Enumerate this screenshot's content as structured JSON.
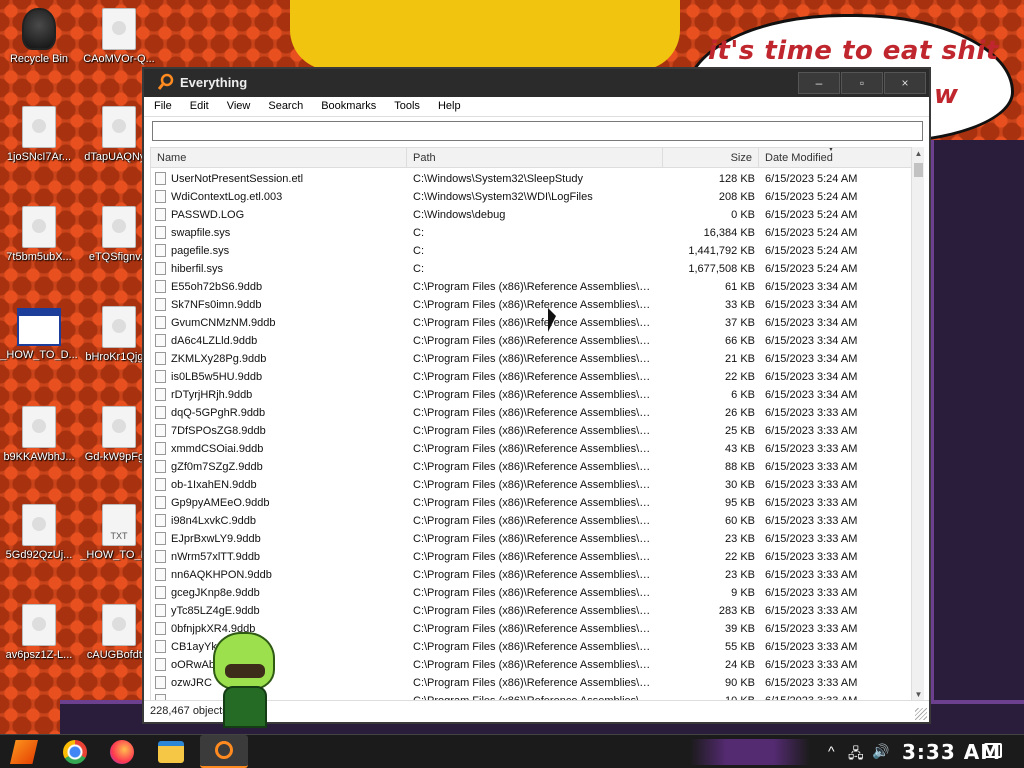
{
  "desktop": {
    "speech_text": "it's time to eat shit",
    "speech_text2": "w",
    "icons": [
      {
        "label": "Recycle Bin"
      },
      {
        "label": "CAoMVOr-Q..."
      },
      {
        "label": "1joSNcI7Ar..."
      },
      {
        "label": "dTapUAQNy..."
      },
      {
        "label": "7t5bm5ubX..."
      },
      {
        "label": "eTQSfignv..."
      },
      {
        "label": "_HOW_TO_D..."
      },
      {
        "label": "bHroKr1Qjg..."
      },
      {
        "label": "b9KKAWbhJ..."
      },
      {
        "label": "Gd-kW9pFg..."
      },
      {
        "label": "5Gd92QzUj..."
      },
      {
        "label": "_HOW_TO_D..."
      },
      {
        "label": "av6psz1Z-L..."
      },
      {
        "label": "cAUGBofdt..."
      }
    ],
    "txt_badge": "TXT"
  },
  "window": {
    "title": "Everything",
    "minimize": "–",
    "maximize": "▫",
    "close": "×",
    "menu": [
      "File",
      "Edit",
      "View",
      "Search",
      "Bookmarks",
      "Tools",
      "Help"
    ],
    "search_value": "",
    "columns": {
      "name": "Name",
      "path": "Path",
      "size": "Size",
      "date": "Date Modified"
    },
    "rows": [
      {
        "name": "UserNotPresentSession.etl",
        "path": "C:\\Windows\\System32\\SleepStudy",
        "size": "128 KB",
        "date": "6/15/2023 5:24 AM"
      },
      {
        "name": "WdiContextLog.etl.003",
        "path": "C:\\Windows\\System32\\WDI\\LogFiles",
        "size": "208 KB",
        "date": "6/15/2023 5:24 AM"
      },
      {
        "name": "PASSWD.LOG",
        "path": "C:\\Windows\\debug",
        "size": "0 KB",
        "date": "6/15/2023 5:24 AM"
      },
      {
        "name": "swapfile.sys",
        "path": "C:",
        "size": "16,384 KB",
        "date": "6/15/2023 5:24 AM"
      },
      {
        "name": "pagefile.sys",
        "path": "C:",
        "size": "1,441,792 KB",
        "date": "6/15/2023 5:24 AM"
      },
      {
        "name": "hiberfil.sys",
        "path": "C:",
        "size": "1,677,508 KB",
        "date": "6/15/2023 5:24 AM"
      },
      {
        "name": "E55oh72bS6.9ddb",
        "path": "C:\\Program Files (x86)\\Reference Assemblies\\Mic...",
        "size": "61 KB",
        "date": "6/15/2023 3:34 AM"
      },
      {
        "name": "Sk7NFs0imn.9ddb",
        "path": "C:\\Program Files (x86)\\Reference Assemblies\\Mic...",
        "size": "33 KB",
        "date": "6/15/2023 3:34 AM"
      },
      {
        "name": "GvumCNMzNM.9ddb",
        "path": "C:\\Program Files (x86)\\Reference Assemblies\\Mic...",
        "size": "37 KB",
        "date": "6/15/2023 3:34 AM"
      },
      {
        "name": "dA6c4LZLld.9ddb",
        "path": "C:\\Program Files (x86)\\Reference Assemblies\\Mic...",
        "size": "66 KB",
        "date": "6/15/2023 3:34 AM"
      },
      {
        "name": "ZKMLXy28Pg.9ddb",
        "path": "C:\\Program Files (x86)\\Reference Assemblies\\Mic...",
        "size": "21 KB",
        "date": "6/15/2023 3:34 AM"
      },
      {
        "name": "is0LB5w5HU.9ddb",
        "path": "C:\\Program Files (x86)\\Reference Assemblies\\Mic...",
        "size": "22 KB",
        "date": "6/15/2023 3:34 AM"
      },
      {
        "name": "rDTyrjHRjh.9ddb",
        "path": "C:\\Program Files (x86)\\Reference Assemblies\\Mic...",
        "size": "6 KB",
        "date": "6/15/2023 3:34 AM"
      },
      {
        "name": "dqQ-5GPghR.9ddb",
        "path": "C:\\Program Files (x86)\\Reference Assemblies\\Mic...",
        "size": "26 KB",
        "date": "6/15/2023 3:33 AM"
      },
      {
        "name": "7DfSPOsZG8.9ddb",
        "path": "C:\\Program Files (x86)\\Reference Assemblies\\Mic...",
        "size": "25 KB",
        "date": "6/15/2023 3:33 AM"
      },
      {
        "name": "xmmdCSOiai.9ddb",
        "path": "C:\\Program Files (x86)\\Reference Assemblies\\Mic...",
        "size": "43 KB",
        "date": "6/15/2023 3:33 AM"
      },
      {
        "name": "gZf0m7SZgZ.9ddb",
        "path": "C:\\Program Files (x86)\\Reference Assemblies\\Mic...",
        "size": "88 KB",
        "date": "6/15/2023 3:33 AM"
      },
      {
        "name": "ob-1IxahEN.9ddb",
        "path": "C:\\Program Files (x86)\\Reference Assemblies\\Mic...",
        "size": "30 KB",
        "date": "6/15/2023 3:33 AM"
      },
      {
        "name": "Gp9pyAMEeO.9ddb",
        "path": "C:\\Program Files (x86)\\Reference Assemblies\\Mic...",
        "size": "95 KB",
        "date": "6/15/2023 3:33 AM"
      },
      {
        "name": "i98n4LxvkC.9ddb",
        "path": "C:\\Program Files (x86)\\Reference Assemblies\\Mic...",
        "size": "60 KB",
        "date": "6/15/2023 3:33 AM"
      },
      {
        "name": "EJprBxwLY9.9ddb",
        "path": "C:\\Program Files (x86)\\Reference Assemblies\\Mic...",
        "size": "23 KB",
        "date": "6/15/2023 3:33 AM"
      },
      {
        "name": "nWrm57xlTT.9ddb",
        "path": "C:\\Program Files (x86)\\Reference Assemblies\\Mic...",
        "size": "22 KB",
        "date": "6/15/2023 3:33 AM"
      },
      {
        "name": "nn6AQKHPON.9ddb",
        "path": "C:\\Program Files (x86)\\Reference Assemblies\\Mic...",
        "size": "23 KB",
        "date": "6/15/2023 3:33 AM"
      },
      {
        "name": "gcegJKnp8e.9ddb",
        "path": "C:\\Program Files (x86)\\Reference Assemblies\\Mic...",
        "size": "9 KB",
        "date": "6/15/2023 3:33 AM"
      },
      {
        "name": "yTc85LZ4gE.9ddb",
        "path": "C:\\Program Files (x86)\\Reference Assemblies\\Mic...",
        "size": "283 KB",
        "date": "6/15/2023 3:33 AM"
      },
      {
        "name": "0bfnjpkXR4.9ddb",
        "path": "C:\\Program Files (x86)\\Reference Assemblies\\Mic...",
        "size": "39 KB",
        "date": "6/15/2023 3:33 AM"
      },
      {
        "name": "CB1ayYk4wF",
        "path": "C:\\Program Files (x86)\\Reference Assemblies\\Mic...",
        "size": "55 KB",
        "date": "6/15/2023 3:33 AM"
      },
      {
        "name": "oORwAb",
        "path": "C:\\Program Files (x86)\\Reference Assemblies\\Mic...",
        "size": "24 KB",
        "date": "6/15/2023 3:33 AM"
      },
      {
        "name": "ozwJRC",
        "path": "C:\\Program Files (x86)\\Reference Assemblies\\Mic...",
        "size": "90 KB",
        "date": "6/15/2023 3:33 AM"
      },
      {
        "name": "",
        "path": "C:\\Program Files (x86)\\Reference Assemblies\\Mic...",
        "size": "10 KB",
        "date": "6/15/2023 3:33 AM"
      }
    ],
    "status": "228,467 objects"
  },
  "taskbar": {
    "clock": "3:33 AM",
    "tray_up": "^",
    "tray_network": "🖧",
    "tray_volume": "🔊"
  },
  "colors": {
    "accent": "#ff8a1f",
    "wallpaper": "#c9441a",
    "titlebar": "#2b2b2b"
  }
}
